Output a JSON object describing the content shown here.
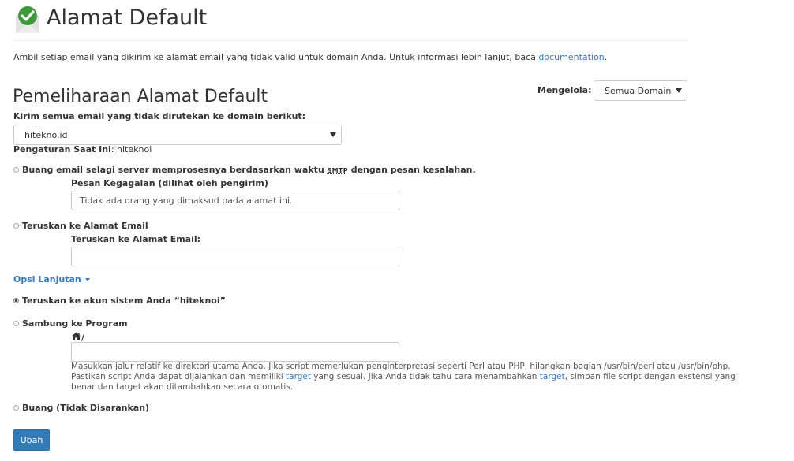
{
  "header": {
    "title": "Alamat Default",
    "icon": "envelope-check-icon"
  },
  "description": {
    "text": "Ambil setiap email yang dikirim ke alamat email yang tidak valid untuk domain Anda. Untuk informasi lebih lanjut, baca ",
    "link": "documentation",
    "suffix": "."
  },
  "section": {
    "title": "Pemeliharaan Alamat Default"
  },
  "manage": {
    "label": "Mengelola:",
    "selected": "Semua Domain"
  },
  "domain": {
    "label": "Kirim semua email yang tidak dirutekan ke domain berikut:",
    "selected": "hitekno.id"
  },
  "current": {
    "label": "Pengaturan Saat Ini",
    "value": ": hiteknoi"
  },
  "options": {
    "discard_bounce": {
      "label_before": "Buang email selagi server memprosesnya berdasarkan waktu ",
      "smtp": "SMTP",
      "label_after": " dengan pesan kesalahan.",
      "checked": false,
      "field_label": "Pesan Kegagalan (dilihat oleh pengirim)",
      "field_value": "Tidak ada orang yang dimaksud pada alamat ini."
    },
    "forward_email": {
      "label": "Teruskan ke Alamat Email",
      "checked": false,
      "field_label": "Teruskan ke Alamat Email:",
      "field_value": ""
    },
    "advanced": {
      "label": "Opsi Lanjutan"
    },
    "forward_system": {
      "label": "Teruskan ke akun sistem Anda “hiteknoi”",
      "checked": true
    },
    "pipe_program": {
      "label": "Sambung ke Program",
      "checked": false,
      "path_prefix": "/",
      "field_value": "",
      "help_part1": "Masukkan jalur relatif ke direktori utama Anda. Jika script memerlukan penginterpretasi seperti Perl atau PHP, hilangkan bagian /usr/bin/perl atau /usr/bin/php. Pastikan script Anda dapat dijalankan dan memiliki ",
      "help_link1": "target",
      "help_part2": " yang sesuai. Jika Anda tidak tahu cara menambahkan ",
      "help_link2": "target",
      "help_part3": ", simpan file script dengan ekstensi yang benar dan target akan ditambahkan secara otomatis."
    },
    "discard": {
      "label": "Buang (Tidak Disarankan)",
      "checked": false
    }
  },
  "submit": {
    "label": "Ubah"
  },
  "colors": {
    "link": "#337ab7",
    "button": "#337ab7",
    "icon_green": "#3c9a3c"
  }
}
